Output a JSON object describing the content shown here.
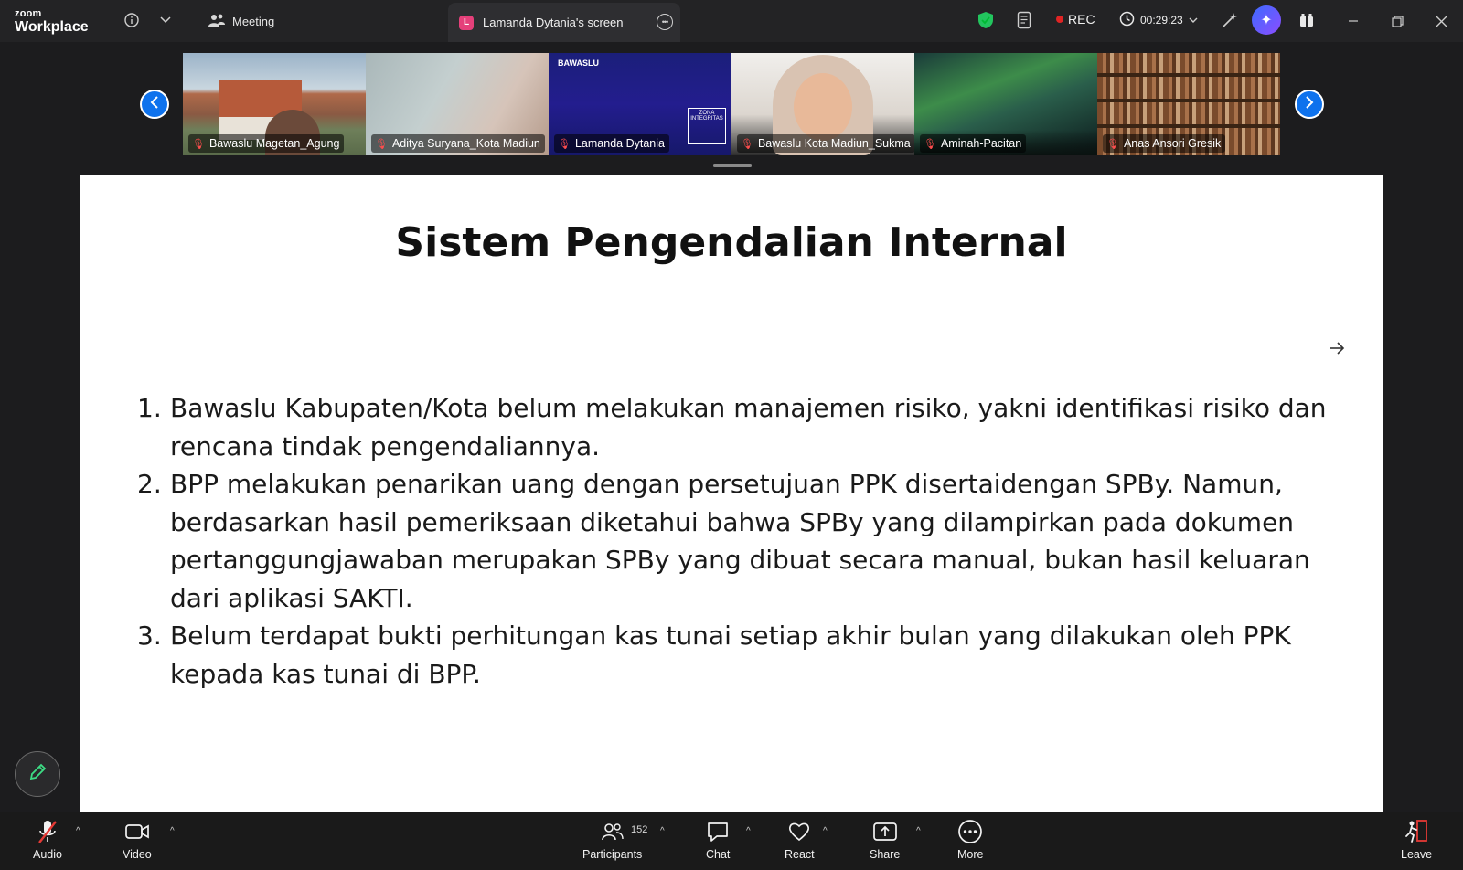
{
  "app": {
    "logo_line1": "zoom",
    "logo_line2": "Workplace"
  },
  "tabs": {
    "meeting_label": "Meeting",
    "screen_label": "Lamanda Dytania's screen",
    "screen_badge": "L"
  },
  "status": {
    "rec_label": "REC",
    "timer": "00:29:23"
  },
  "participants_strip": [
    {
      "name": "Bawaslu Magetan_Agung"
    },
    {
      "name": "Aditya Suryana_Kota Madiun"
    },
    {
      "name": "Lamanda Dytania"
    },
    {
      "name": "Bawaslu Kota Madiun_Sukma"
    },
    {
      "name": "Aminah-Pacitan"
    },
    {
      "name": "Anas Ansori Gresik"
    }
  ],
  "tile_texts": {
    "bawaslu_logo": "BAWASLU",
    "zona": "ZONA INTEGRITAS"
  },
  "slide": {
    "title": "Sistem Pengendalian Internal",
    "items": [
      {
        "num": "1.",
        "text": "Bawaslu Kabupaten/Kota belum melakukan manajemen risiko, yakni identifikasi risiko dan rencana tindak pengendaliannya."
      },
      {
        "num": "2.",
        "text": "BPP melakukan penarikan uang dengan persetujuan PPK disertaidengan SPBy. Namun, berdasarkan hasil pemeriksaan diketahui bahwa SPBy yang dilampirkan pada dokumen pertanggungjawaban merupakan SPBy yang dibuat secara manual, bukan hasil keluaran dari aplikasi SAKTI."
      },
      {
        "num": "3.",
        "text": "Belum terdapat bukti perhitungan kas tunai setiap akhir bulan yang dilakukan oleh PPK kepada kas tunai di BPP."
      }
    ]
  },
  "toolbar": {
    "audio": "Audio",
    "video": "Video",
    "participants": "Participants",
    "participants_count": "152",
    "chat": "Chat",
    "react": "React",
    "share": "Share",
    "more": "More",
    "leave": "Leave"
  },
  "colors": {
    "accent": "#0e72ed",
    "rec": "#e02424",
    "shield": "#22c55e",
    "pen": "#3ddc84"
  }
}
